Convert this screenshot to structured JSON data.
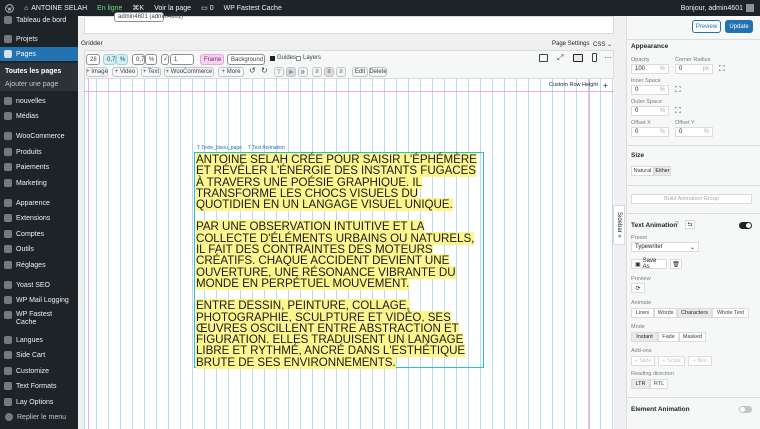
{
  "adminbar": {
    "site_name": "ANTOINE SELAH",
    "status": "En ligne",
    "shortcut": "⌘K",
    "view_page": "Voir la page",
    "comments_count": "0",
    "cache": "WP Fastest Cache",
    "greeting": "Bonjour, admin4601"
  },
  "sidebar": {
    "items": [
      {
        "label": "Tableau de bord",
        "icon": "dashboard-icon"
      },
      {
        "label": "Projets",
        "icon": "pin-icon"
      },
      {
        "label": "Pages",
        "icon": "pages-icon"
      },
      {
        "label": "Toutes les pages",
        "icon": ""
      },
      {
        "label": "Ajouter une page",
        "icon": ""
      },
      {
        "label": "nouvelles",
        "icon": "pin-icon"
      },
      {
        "label": "Médias",
        "icon": "media-icon"
      },
      {
        "label": "WooCommerce",
        "icon": "woocommerce-icon"
      },
      {
        "label": "Produits",
        "icon": "products-icon"
      },
      {
        "label": "Paiements",
        "icon": "payments-icon"
      },
      {
        "label": "Marketing",
        "icon": "marketing-icon"
      },
      {
        "label": "Apparence",
        "icon": "appearance-icon"
      },
      {
        "label": "Extensions",
        "icon": "plugins-icon"
      },
      {
        "label": "Comptes",
        "icon": "users-icon"
      },
      {
        "label": "Outils",
        "icon": "tools-icon"
      },
      {
        "label": "Réglages",
        "icon": "settings-icon"
      },
      {
        "label": "Yoast SEO",
        "icon": "yoast-icon"
      },
      {
        "label": "WP Mail Logging",
        "icon": "mail-icon"
      },
      {
        "label": "WP Fastest Cache",
        "icon": "cache-icon"
      },
      {
        "label": "Langues",
        "icon": "languages-icon"
      },
      {
        "label": "Side Cart",
        "icon": "cart-icon"
      },
      {
        "label": "Customize",
        "icon": "customize-icon"
      },
      {
        "label": "Text Formats",
        "icon": "text-formats-icon"
      },
      {
        "label": "Lay Options",
        "icon": "lay-options-icon"
      },
      {
        "label": "Replier le menu",
        "icon": "collapse-icon"
      }
    ]
  },
  "main": {
    "author_select": "admin4601 (admin4601)",
    "gridder_label": "Gridder",
    "page_settings": "Page Settings",
    "css_label": "CSS",
    "toolbar1": {
      "cols": "28",
      "gap1": "0,7",
      "unit1": "%",
      "gap2": "0,7",
      "unit2": "%",
      "row": "1",
      "frame": "Frame",
      "background": "Background",
      "guides": "Guides",
      "layers": "Layers"
    },
    "toolbar2": {
      "image": "+ Image",
      "video": "+ Video",
      "text": "+ Text",
      "woocommerce": "+ WooCommerce",
      "more": "+ More",
      "edit": "Edit",
      "delete": "Delete"
    },
    "custom_row_height": "Custom Row Height",
    "tags": {
      "texte": "Texte_bisou_page",
      "anim": "Text Animation"
    },
    "paragraphs": [
      "ANTOINE SELAH CRÉE POUR SAISIR L'ÉPHÉMÈRE ET RÉVÉLER L'ÉNERGIE DES INSTANTS FUGACES À TRAVERS UNE POÉSIE GRAPHIQUE. IL TRANSFORME LES CHOCS VISUELS DU QUOTIDIEN EN UN LANGAGE VISUEL UNIQUE.",
      "PAR UNE OBSERVATION INTUITIVE ET LA COLLECTE D'ÉLÉMENTS URBAINS OU NATURELS, IL FAIT DES CONTRAINTES DES MOTEURS CRÉATIFS. CHAQUE ACCIDENT DEVIENT UNE OUVERTURE, UNE RÉSONANCE VIBRANTE DU MONDE EN PERPÉTUEL MOUVEMENT.",
      "ENTRE DESSIN, PEINTURE, COLLAGE, PHOTOGRAPHIE, SCULPTURE ET VIDÉO, SES ŒUVRES OSCILLENT ENTRE ABSTRACTION ET FIGURATION. ELLES TRADUISENT UN LANGAGE LIBRE ET RYTHMÉ, ANCRÉ DANS L'ESTHÉTIQUE BRUTE DE SES ENVIRONNEMENTS."
    ]
  },
  "panel": {
    "preview": "Preview",
    "update": "Update",
    "sidebar_tab": "Sidebar »",
    "appearance": "Appearance",
    "opacity_label": "Opacity",
    "opacity_value": "100",
    "opacity_unit": "%",
    "corner_label": "Corner Radius",
    "corner_value": "0",
    "corner_unit": "px",
    "inner_label": "Inner Space",
    "inner_value": "0",
    "inner_unit": "%",
    "outer_label": "Outer Space",
    "outer_value": "0",
    "outer_unit": "%",
    "offx_label": "Offset X",
    "offx_value": "0",
    "offx_unit": "%",
    "offy_label": "Offset Y",
    "offy_value": "0",
    "offy_unit": "%",
    "size": "Size",
    "size_natural": "Natural",
    "size_either": "Either",
    "build_group": "Build Animation Group",
    "text_animation": "Text Animation",
    "preset_label": "Preset",
    "preset_value": "Typewriter",
    "save_as": "Save As",
    "preview_label": "Preview",
    "animate_label": "Animate",
    "animate_lines": "Lines",
    "animate_words": "Words",
    "animate_chars": "Characters",
    "animate_whole": "Whole Text",
    "mode_label": "Mode",
    "mode_instant": "Instant",
    "mode_fade": "Fade",
    "mode_masked": "Masked",
    "addons_label": "Add-ons",
    "addon_slide": "+ Slide",
    "addon_scale": "+ Scale",
    "addon_blur": "+ Blur",
    "direction_label": "Reading direction",
    "dir_ltr": "LTR",
    "dir_rtl": "RTL",
    "element_animation": "Element Animation"
  },
  "colors": {
    "accent": "#2271b1",
    "admin_dark": "#1d2327",
    "highlight": "#fdf58d",
    "frame": "#2bc0c9"
  }
}
